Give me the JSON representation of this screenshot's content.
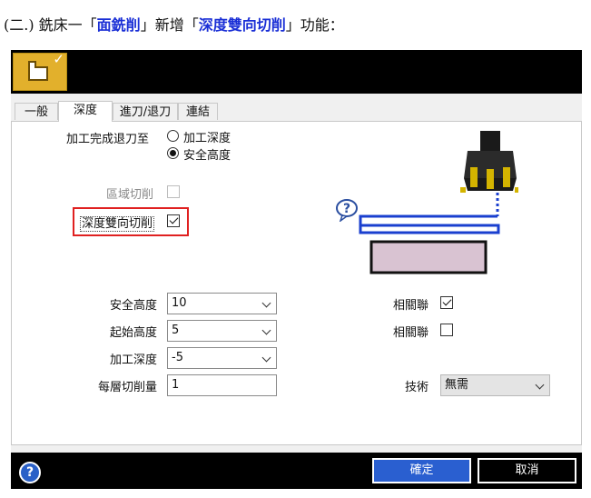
{
  "heading": {
    "prefix": "(二.) 銑床一「",
    "em1": "面銑削",
    "mid": "」新增「",
    "em2": "深度雙向切削",
    "suffix": "」功能："
  },
  "tabs": [
    "一般",
    "深度",
    "進刀/退刀",
    "連結"
  ],
  "form": {
    "retract_label": "加工完成退刀至",
    "retract_options": [
      "加工深度",
      "安全高度"
    ],
    "area_cut_label": "區域切削",
    "bidir_label": "深度雙向切削",
    "safe_height_label": "安全高度",
    "safe_height_value": "10",
    "start_height_label": "起始高度",
    "start_height_value": "5",
    "cut_depth_label": "加工深度",
    "cut_depth_value": "-5",
    "layer_amount_label": "每層切削量",
    "layer_amount_value": "1",
    "related1_label": "相關聯",
    "related2_label": "相關聯",
    "technique_label": "技術",
    "technique_value": "無需"
  },
  "buttons": {
    "ok": "確定",
    "cancel": "取消"
  },
  "help_glyph": "?",
  "colors": {
    "accent": "#2a5fd0",
    "highlight": "#e02020",
    "heading_em": "#1a2fd6",
    "app_icon": "#e2b02c"
  }
}
